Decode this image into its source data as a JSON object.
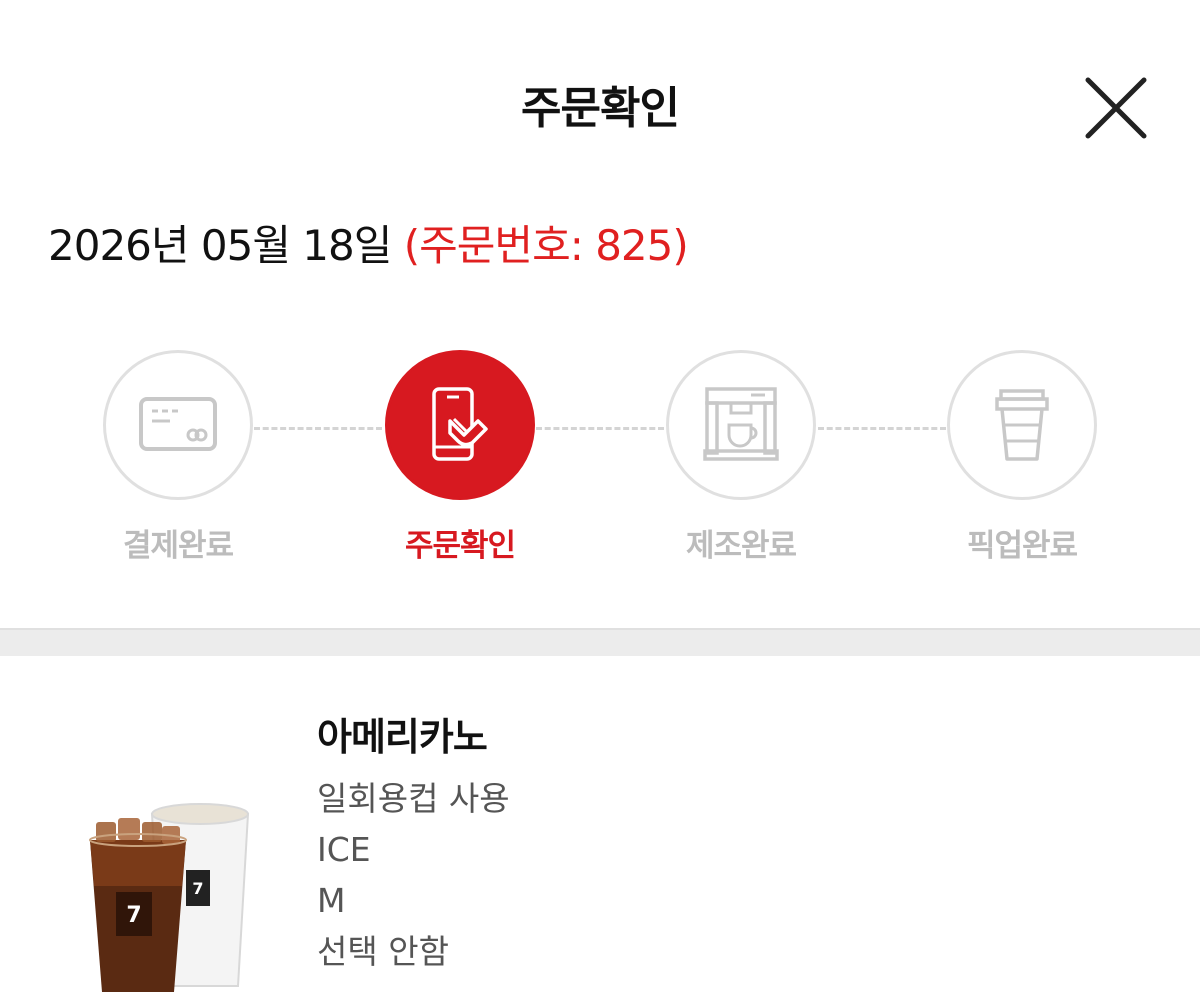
{
  "header": {
    "title": "주문확인",
    "close_icon": "close-icon"
  },
  "order": {
    "date": "2026년 05월 18일",
    "order_number_text": "(주문번호: 825)"
  },
  "colors": {
    "accent": "#d71920",
    "inactive": "#bcbcbc",
    "order_number": "#e02020"
  },
  "steps": [
    {
      "label": "결제완료",
      "icon": "credit-card-icon",
      "active": false
    },
    {
      "label": "주문확인",
      "icon": "mobile-order-icon",
      "active": true
    },
    {
      "label": "제조완료",
      "icon": "coffee-machine-icon",
      "active": false
    },
    {
      "label": "픽업완료",
      "icon": "takeout-cup-icon",
      "active": false
    }
  ],
  "item": {
    "name": "아메리카노",
    "image": "americano-drink-image",
    "options": [
      "일회용컵 사용",
      "ICE",
      "M",
      "선택 안함"
    ]
  }
}
